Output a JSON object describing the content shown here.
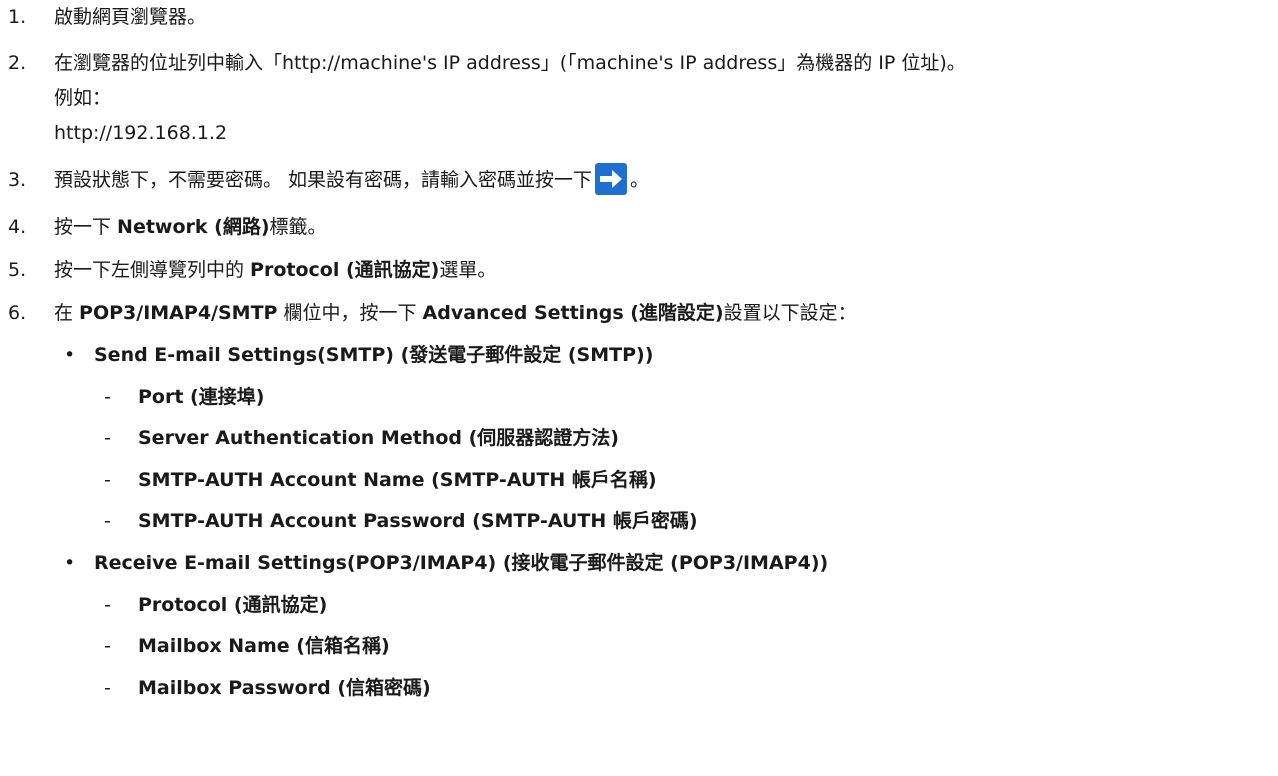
{
  "steps": [
    {
      "num": "1.",
      "text": "啟動網頁瀏覽器。"
    },
    {
      "num": "2.",
      "text": "在瀏覽器的位址列中輸入「http://machine's IP address」(「machine's IP address」為機器的 IP 位址)。",
      "example_label": "例如：",
      "example_value": "http://192.168.1.2"
    },
    {
      "num": "3.",
      "text_before": "預設狀態下，不需要密碼。 如果設有密碼，請輸入密碼並按一下",
      "icon": "arrow-right-icon",
      "text_after": "。"
    },
    {
      "num": "4.",
      "prefix": "按一下 ",
      "bold": "Network (網路)",
      "suffix": "標籤。"
    },
    {
      "num": "5.",
      "prefix": "按一下左側導覽列中的 ",
      "bold": "Protocol (通訊協定)",
      "suffix": "選單。"
    },
    {
      "num": "6.",
      "prefix": "在 ",
      "bold1": "POP3/IMAP4/SMTP",
      "mid": " 欄位中，按一下 ",
      "bold2": "Advanced Settings (進階設定)",
      "suffix": "設置以下設定："
    }
  ],
  "settings": [
    {
      "bullet": "•",
      "title": "Send E-mail Settings(SMTP) (發送電子郵件設定 (SMTP))",
      "items": [
        "Port (連接埠)",
        "Server Authentication Method (伺服器認證方法)",
        "SMTP-AUTH Account Name (SMTP-AUTH 帳戶名稱)",
        "SMTP-AUTH Account Password (SMTP-AUTH 帳戶密碼)"
      ]
    },
    {
      "bullet": "•",
      "title": "Receive E-mail Settings(POP3/IMAP4) (接收電子郵件設定 (POP3/IMAP4))",
      "items": [
        "Protocol (通訊協定)",
        "Mailbox Name (信箱名稱)",
        "Mailbox Password (信箱密碼)"
      ]
    }
  ],
  "dash": "-",
  "colors": {
    "arrow_button": "#1e6fd0",
    "arrow": "#ffffff"
  }
}
